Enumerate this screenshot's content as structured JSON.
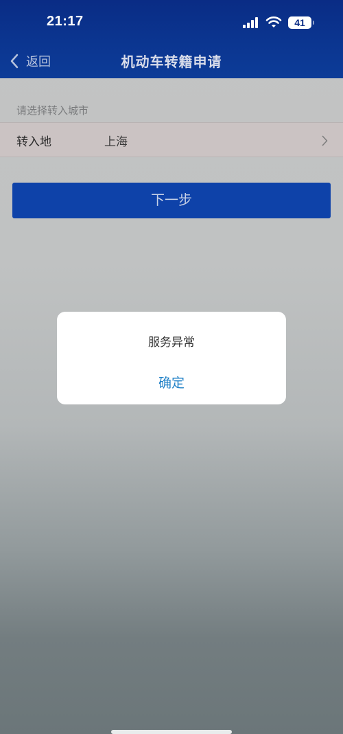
{
  "status_bar": {
    "time": "21:17",
    "battery": "41",
    "icons": [
      "signal-icon",
      "wifi-icon",
      "battery-icon"
    ]
  },
  "nav": {
    "back_label": "返回",
    "title": "机动车转籍申请"
  },
  "form": {
    "section_hint": "请选择转入城市",
    "row_label": "转入地",
    "row_value": "上海",
    "next_button": "下一步"
  },
  "dialog": {
    "message": "服务异常",
    "confirm_label": "确定"
  },
  "colors": {
    "nav_bar": "#0b3590",
    "primary_button": "#0e42a9",
    "dialog_action": "#1d7fc6"
  }
}
